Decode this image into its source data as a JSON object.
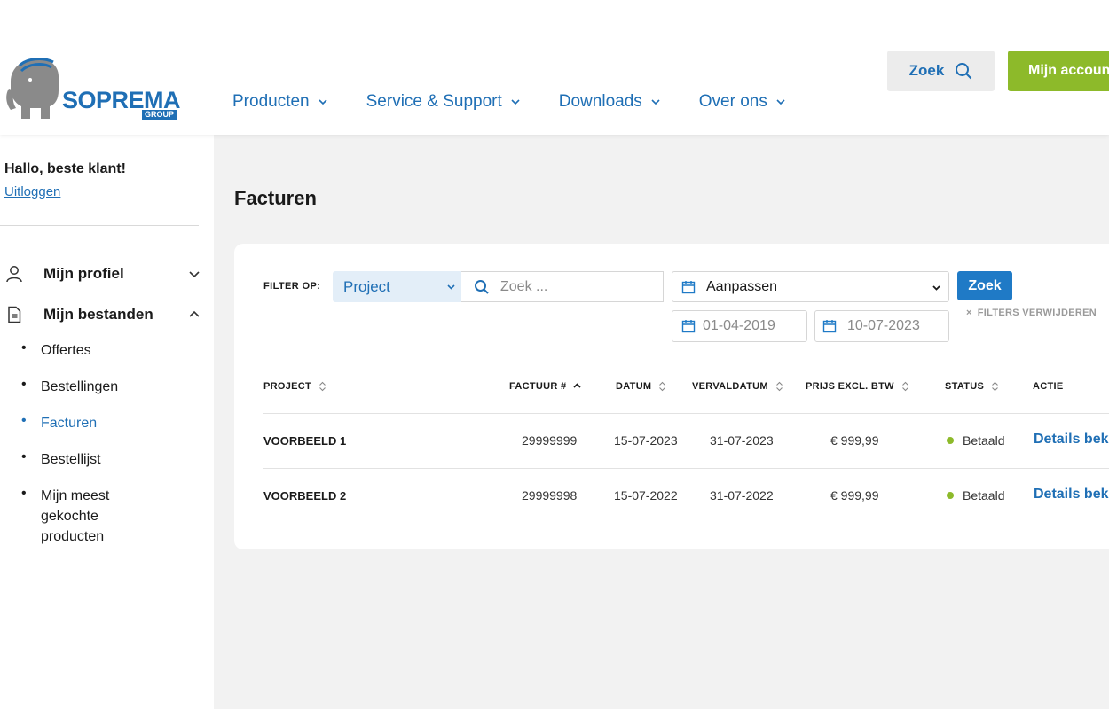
{
  "brand": {
    "name": "SOPREMA",
    "sub": "GROUP",
    "primary_color": "#1f6fb5",
    "accent_color": "#8dba2a"
  },
  "header": {
    "nav": [
      {
        "label": "Producten"
      },
      {
        "label": "Service & Support"
      },
      {
        "label": "Downloads"
      },
      {
        "label": "Over ons"
      }
    ],
    "search_label": "Zoek",
    "account_label": "Mijn account"
  },
  "sidebar": {
    "greeting": "Hallo, beste klant!",
    "logout": "Uitloggen",
    "groups": [
      {
        "label": "Mijn profiel",
        "icon": "user-icon",
        "expanded": false
      },
      {
        "label": "Mijn bestanden",
        "icon": "document-icon",
        "expanded": true
      }
    ],
    "items": [
      {
        "label": "Offertes"
      },
      {
        "label": "Bestellingen"
      },
      {
        "label": "Facturen",
        "active": true
      },
      {
        "label": "Bestellijst"
      },
      {
        "label": "Mijn meest gekochte producten"
      }
    ]
  },
  "main": {
    "title": "Facturen",
    "filters": {
      "label": "FILTER OP:",
      "field_selected": "Project",
      "search_placeholder": "Zoek ...",
      "period_selected": "Aanpassen",
      "submit_label": "Zoek",
      "date_from": "01-04-2019",
      "date_to": "10-07-2023",
      "clear_label": "FILTERS VERWIJDEREN"
    },
    "table": {
      "columns": [
        "PROJECT",
        "FACTUUR #",
        "DATUM",
        "VERVALDATUM",
        "PRIJS EXCL. BTW",
        "STATUS",
        "ACTIE"
      ],
      "rows": [
        {
          "project": "VOORBEELD 1",
          "invoice": "29999999",
          "date": "15-07-2023",
          "due": "31-07-2023",
          "price": "€ 999,99",
          "status": "Betaald",
          "action": "Details bekijken"
        },
        {
          "project": "VOORBEELD 2",
          "invoice": "29999998",
          "date": "15-07-2022",
          "due": "31-07-2022",
          "price": "€ 999,99",
          "status": "Betaald",
          "action": "Details bekijken"
        }
      ]
    }
  }
}
